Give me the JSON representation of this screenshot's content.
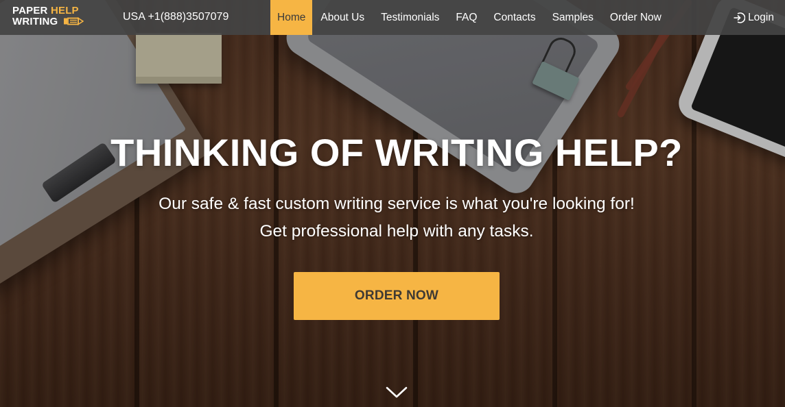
{
  "brand": {
    "line1": "PAPER",
    "line1_accent": "HELP",
    "line2": "WRITING",
    "accent_color": "#f6b544"
  },
  "header": {
    "phone": "USA +1(888)3507079",
    "nav": [
      {
        "label": "Home",
        "active": true
      },
      {
        "label": "About Us",
        "active": false
      },
      {
        "label": "Testimonials",
        "active": false
      },
      {
        "label": "FAQ",
        "active": false
      },
      {
        "label": "Contacts",
        "active": false
      },
      {
        "label": "Samples",
        "active": false
      },
      {
        "label": "Order Now",
        "active": false
      }
    ],
    "login_label": "Login",
    "login_icon": "login-icon",
    "bar_color": "#444444"
  },
  "hero": {
    "headline": "THINKING OF WRITING HELP?",
    "subline_1": "Our safe & fast custom writing service is what you're looking for!",
    "subline_2": "Get professional help with any tasks.",
    "cta_label": "ORDER NOW",
    "cta_color": "#f6b544",
    "scroll_icon": "chevron-down-icon"
  }
}
